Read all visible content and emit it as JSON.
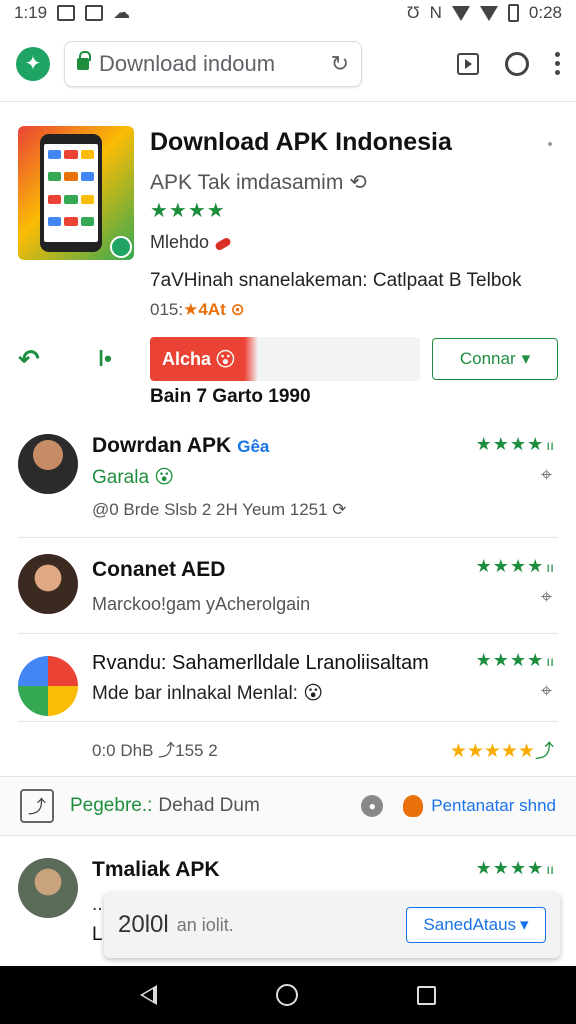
{
  "status_bar": {
    "time_left": "1:19",
    "time_right": "0:28"
  },
  "toolbar": {
    "url": "Download indoum",
    "reload_icon": "reload-icon"
  },
  "app": {
    "title": "Download APK Indonesia",
    "subtitle": "APK Tak imdasamim",
    "stars": "★★★★",
    "developer": "Mlehdo",
    "description": "7aVHinah snanelakeman: Catlpaat B Telbok",
    "meta_prefix": "015:",
    "meta_accent": "★4At",
    "meta_suffix": " ⊙"
  },
  "actions": {
    "install_label": "Alcha",
    "install_emoji": "😮",
    "continue_label": "Connar",
    "download_line": "Bain 7 Garto 1990"
  },
  "reviews": [
    {
      "name": "Dowrdan APK",
      "tag": "Gêa",
      "line2": "Garala 😮",
      "line3": "@0 Brde Slsb 2 2H Yeum 1251 ⟳",
      "stars": "★★★★",
      "rating": "ıı"
    },
    {
      "name": "Conanet AED",
      "line2": "Marckoo!gam yAcherolgain",
      "stars": "★★★★",
      "rating": "ıı"
    },
    {
      "name": "Rvandu: Sahamerlldale Lranoliisaltam",
      "line2": "Mde bar inlnakal Menlal: 😮",
      "line3": "0:0 DhB ⤴155 2",
      "stars": "★★★★",
      "rating": "ıı",
      "bottom_stars": "★★★★★",
      "bottom_rating": "⤴"
    },
    {
      "name": "Tmaliak APK",
      "line2": "..",
      "line3": "L",
      "stars": "★★★★",
      "rating": "ıı"
    }
  ],
  "promo": {
    "label": "Pegebre.:",
    "label_gray": "Dehad Dum",
    "link": "Pentanatar shnd"
  },
  "popup": {
    "count": "20l0l",
    "note": "an iolit.",
    "button": "SanedAtaus"
  },
  "colors": {
    "accent_green": "#1e8e3e",
    "install_red": "#ea4335",
    "link_blue": "#1a73e8",
    "star_orange": "#f9ab00"
  }
}
